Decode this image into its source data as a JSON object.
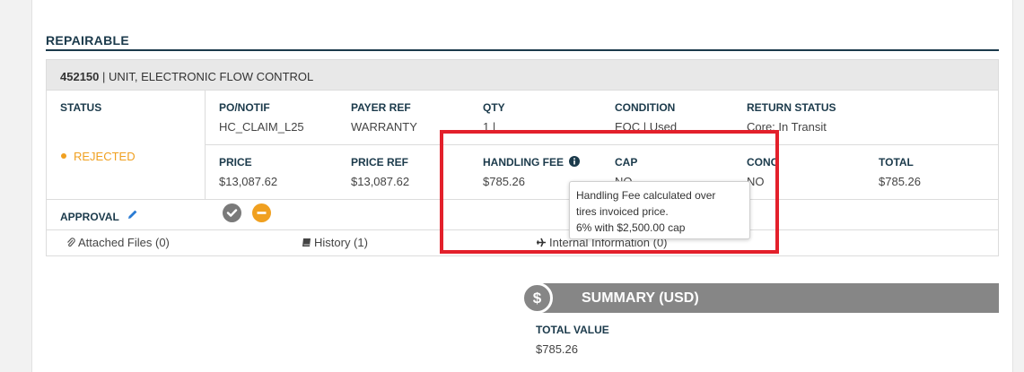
{
  "section": {
    "title": "REPAIRABLE"
  },
  "part": {
    "number": "452150",
    "separator": " | ",
    "description": "UNIT, ELECTRONIC FLOW CONTROL"
  },
  "status": {
    "label": "STATUS",
    "value": "REJECTED",
    "color": "#f0a020"
  },
  "row1": {
    "po_label": "PO/NOTIF",
    "po_value": "HC_CLAIM_L25",
    "payer_label": "PAYER REF",
    "payer_value": "WARRANTY",
    "qty_label": "QTY",
    "qty_value": "1 |",
    "condition_label": "CONDITION",
    "condition_value": "EOC | Used",
    "return_label": "RETURN STATUS",
    "return_value": "Core: In Transit"
  },
  "row2": {
    "price_label": "PRICE",
    "price_value": "$13,087.62",
    "price_ref_label": "PRICE REF",
    "price_ref_value": "$13,087.62",
    "handling_label": "HANDLING FEE",
    "handling_value": "$785.26",
    "cap_label": "CAP",
    "cap_value": "NO",
    "conc_label": "CONC",
    "conc_value": "NO",
    "total_label": "TOTAL",
    "total_value": "$785.26"
  },
  "approval": {
    "label": "APPROVAL",
    "approve_icon": "check-icon",
    "reject_icon": "minus-icon"
  },
  "links": {
    "attached": "Attached Files (0)",
    "history": "History (1)",
    "internal": "Internal Information (0)"
  },
  "tooltip": {
    "line1": "Handling Fee calculated over",
    "line2": "tires invoiced price.",
    "line3": "6% with $2,500.00 cap"
  },
  "summary": {
    "icon": "$",
    "title": "SUMMARY (USD)",
    "total_label": "TOTAL VALUE",
    "total_value": "$785.26"
  },
  "colors": {
    "accent": "#1b3a4b",
    "highlight": "#e3202b",
    "summary_bg": "#868686"
  }
}
